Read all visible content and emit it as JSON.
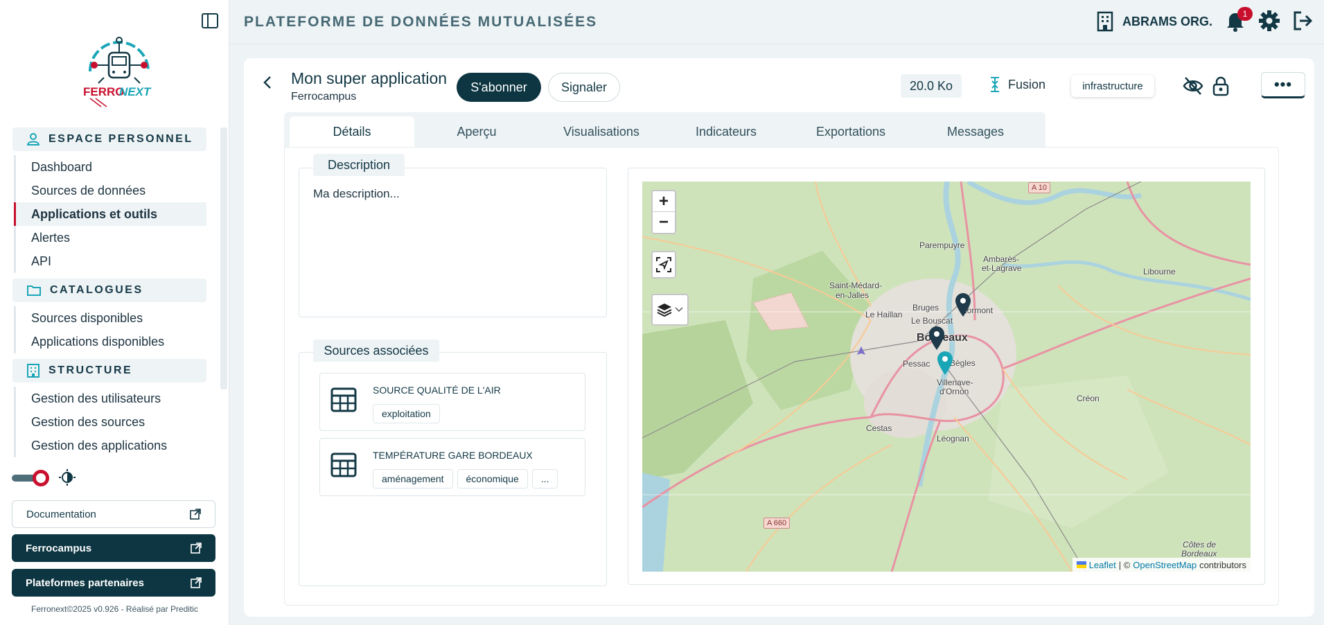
{
  "sidebar": {
    "sections": [
      {
        "title": "ESPACE PERSONNEL",
        "icon": "user-icon",
        "items": [
          {
            "label": "Dashboard",
            "active": false
          },
          {
            "label": "Sources de données",
            "active": false
          },
          {
            "label": "Applications et outils",
            "active": true
          },
          {
            "label": "Alertes",
            "active": false
          },
          {
            "label": "API",
            "active": false
          }
        ]
      },
      {
        "title": "CATALOGUES",
        "icon": "folder-icon",
        "items": [
          {
            "label": "Sources disponibles"
          },
          {
            "label": "Applications disponibles"
          }
        ]
      },
      {
        "title": "STRUCTURE",
        "icon": "building-icon",
        "items": [
          {
            "label": "Gestion des utilisateurs"
          },
          {
            "label": "Gestion des sources"
          },
          {
            "label": "Gestion des applications"
          }
        ]
      }
    ],
    "documentation_label": "Documentation",
    "ferrocampus_label": "Ferrocampus",
    "partners_label": "Plateformes partenaires",
    "footer": "Ferronext©2025 v0.926 - Réalisé par Preditic",
    "logo_text_left": "FERRO",
    "logo_text_right": "NEXT"
  },
  "header": {
    "title": "PLATEFORME DE DONNÉES MUTUALISÉES",
    "org": "ABRAMS ORG.",
    "notifications_count": "1"
  },
  "app": {
    "title": "Mon super application",
    "subtitle": "Ferrocampus",
    "subscribe_label": "S'abonner",
    "report_label": "Signaler",
    "size": "20.0 Ko",
    "merge_label": "Fusion",
    "tag": "infrastructure",
    "more_label": "•••"
  },
  "tabs": [
    "Détails",
    "Aperçu",
    "Visualisations",
    "Indicateurs",
    "Exportations",
    "Messages"
  ],
  "active_tab": "Détails",
  "description": {
    "heading": "Description",
    "text": "Ma description..."
  },
  "sources": {
    "heading": "Sources associées",
    "items": [
      {
        "name": "SOURCE QUALITÉ DE L'AIR",
        "tags": [
          "exploitation"
        ]
      },
      {
        "name": "TEMPÉRATURE GARE BORDEAUX",
        "tags": [
          "aménagement",
          "économique",
          "..."
        ]
      }
    ]
  },
  "map": {
    "zoom_in": "+",
    "zoom_out": "−",
    "places": [
      "Parempuyre",
      "Ambarès-",
      "et-Lagrave",
      "Libourne",
      "Saint-Médard-",
      "en-Jalles",
      "Bruges",
      "Lormont",
      "Le Haillan",
      "Le Bouscat",
      "Bordeaux",
      "Pessac",
      "Bègles",
      "Villenave-",
      "d'Ornon",
      "Créon",
      "Cestas",
      "Léognan",
      "Côtes de",
      "Bordeaux"
    ],
    "roads": [
      "A 10",
      "A 660"
    ],
    "attribution_leaflet": "Leaflet",
    "attribution_sep": "| ©",
    "attribution_osm": "OpenStreetMap",
    "attribution_tail": "contributors",
    "colors": {
      "marker_dark": "#1f3a4a",
      "marker_accent": "#1aa6b7"
    }
  }
}
